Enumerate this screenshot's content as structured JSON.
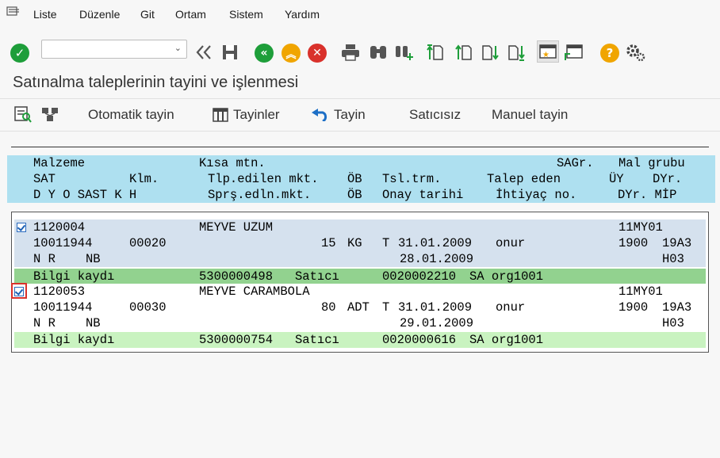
{
  "menu": {
    "items": [
      "Liste",
      "Düzenle",
      "Git",
      "Ortam",
      "Sistem",
      "Yardım"
    ]
  },
  "command_field": {
    "value": "",
    "placeholder": ""
  },
  "page_title": "Satınalma taleplerinin tayini ve işlenmesi",
  "app_toolbar": {
    "otomatik_tayin": "Otomatik tayin",
    "tayinler": "Tayinler",
    "tayin": "Tayin",
    "saticisiz": "Satıcısız",
    "manuel_tayin": "Manuel tayin"
  },
  "list_header": {
    "row1": {
      "c1": "Malzeme",
      "c2": "Kısa mtn.",
      "c3": "SAGr.",
      "c4": "Mal grubu"
    },
    "row2": {
      "c1": "SAT",
      "c2": "Klm.",
      "c3": "Tlp.edilen mkt.",
      "c4": "ÖB",
      "c5": "Tsl.trm.",
      "c6": "Talep eden",
      "c7": "ÜY",
      "c8": "DYr."
    },
    "row3": {
      "c1": "D Y O SAST K H",
      "c2": "Sprş.edln.mkt.",
      "c3": "ÖB",
      "c4": "Onay tarihi",
      "c5": "İhtiyaç no.",
      "c6": "DYr. MİP"
    }
  },
  "items": [
    {
      "checked": true,
      "material": "1120004",
      "short_text": "MEYVE UZUM",
      "material_group": "11MY01",
      "sat": "10011944",
      "item_no": "00020",
      "quantity": "15",
      "unit": "KG",
      "type": "T",
      "delivery_date": "31.01.2009",
      "requester": "onur",
      "uy": "1900",
      "dyr": "19A3",
      "flags": "N R",
      "doc_type": "NB",
      "approval_date": "28.01.2009",
      "mrp": "H03",
      "info_label": "Bilgi kaydı",
      "info_record": "5300000498",
      "vendor_label": "Satıcı",
      "vendor": "0020002210",
      "purch_org": "SA org1001"
    },
    {
      "checked": true,
      "material": "1120053",
      "short_text": "MEYVE CARAMBOLA",
      "material_group": "11MY01",
      "sat": "10011944",
      "item_no": "00030",
      "quantity": "80",
      "unit": "ADT",
      "type": "T",
      "delivery_date": "31.01.2009",
      "requester": "onur",
      "uy": "1900",
      "dyr": "19A3",
      "flags": "N R",
      "doc_type": "NB",
      "approval_date": "29.01.2009",
      "mrp": "H03",
      "info_label": "Bilgi kaydı",
      "info_record": "5300000754",
      "vendor_label": "Satıcı",
      "vendor": "0020000616",
      "purch_org": "SA org1001"
    }
  ],
  "colors": {
    "header_bg": "#aee0f0",
    "row_blue": "#d5e1ee",
    "info_green_dark": "#92d28f",
    "info_green_light": "#c9f3c0",
    "ok_green": "#1e9e3a",
    "cancel_red": "#d9312b",
    "help_orange": "#f0a500"
  }
}
